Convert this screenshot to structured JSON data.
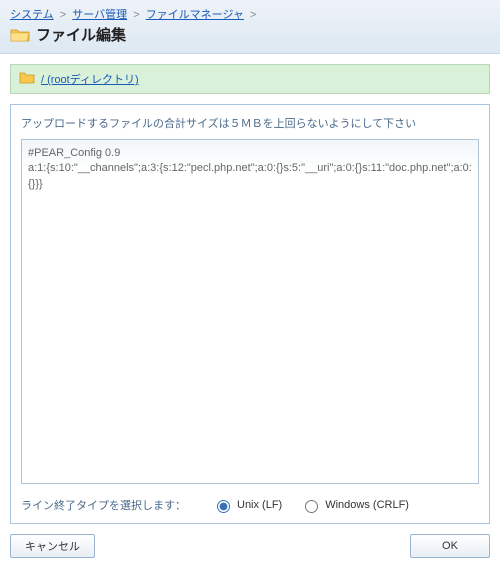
{
  "breadcrumb": {
    "items": [
      {
        "label": "システム"
      },
      {
        "label": "サーバ管理"
      },
      {
        "label": "ファイルマネージャ"
      }
    ],
    "separator": ">"
  },
  "page_title": "ファイル編集",
  "path_bar": {
    "label": "/ (rootディレクトリ)"
  },
  "editor": {
    "note": "アップロードするファイルの合計サイズは５ＭＢを上回らないようにして下さい",
    "content": "#PEAR_Config 0.9\na:1:{s:10:\"__channels\";a:3:{s:12:\"pecl.php.net\";a:0:{}s:5:\"__uri\";a:0:{}s:11:\"doc.php.net\";a:0:{}}}"
  },
  "line_ending": {
    "label": "ライン終了タイプを選択します：",
    "options": [
      {
        "value": "lf",
        "label": "Unix (LF)",
        "selected": true
      },
      {
        "value": "crlf",
        "label": "Windows (CRLF)",
        "selected": false
      }
    ]
  },
  "buttons": {
    "cancel": "キャンセル",
    "ok": "OK"
  },
  "colors": {
    "link": "#1a5ab8",
    "path_bg": "#d9f0d9",
    "border": "#a8c4de"
  }
}
